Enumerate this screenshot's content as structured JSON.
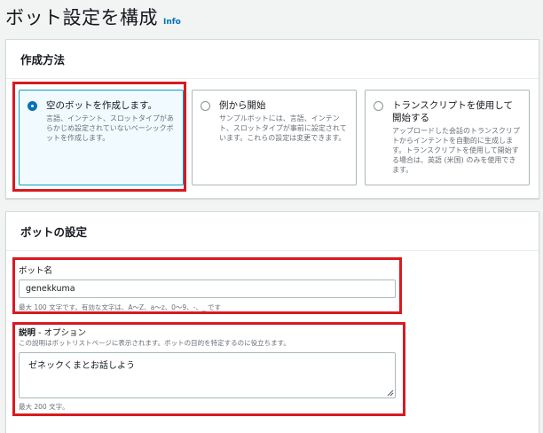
{
  "header": {
    "title": "ボット設定を構成",
    "info_label": "Info"
  },
  "creation_method": {
    "heading": "作成方法",
    "options": [
      {
        "title": "空のボットを作成します。",
        "description": "言語、インテント、スロットタイプがあらかじめ設定されていないベーシックボットを作成します。",
        "selected": true
      },
      {
        "title": "例から開始",
        "description": "サンプルボットには、言語、インテント、スロットタイプが事前に設定されています。これらの設定は変更できます。",
        "selected": false
      },
      {
        "title": "トランスクリプトを使用して開始する",
        "description": "アップロードした会話のトランスクリプトからインテントを自動的に生成します。トランスクリプトを使用して開始する場合は、英語 (米国) のみを使用できます。",
        "selected": false
      }
    ]
  },
  "bot_settings": {
    "heading": "ボットの設定",
    "bot_name": {
      "label": "ボット名",
      "value": "genekkuma",
      "constraint": "最大 100 文字です。有効な文字は、A〜Z、a〜z、0〜9、-、_ です"
    },
    "description": {
      "label": "説明",
      "optional": "- オプション",
      "help": "この説明はボットリストページに表示されます。ボットの目的を特定するのに役立ちます。",
      "value": "ゼネックくまとお話しよう",
      "constraint": "最大 200 文字。"
    }
  },
  "colors": {
    "highlight": "#d81a21",
    "selected_tile_bg": "#f1faff",
    "selected_tile_border": "#00a1c9",
    "link": "#0073bb"
  }
}
